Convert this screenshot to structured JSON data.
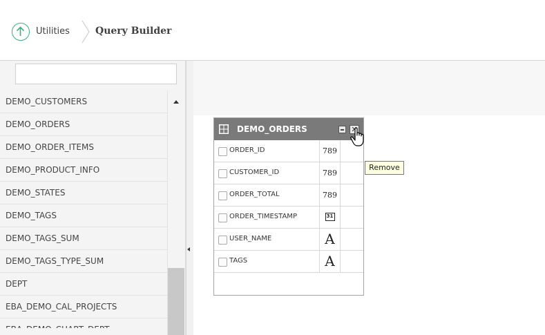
{
  "breadcrumb": {
    "parent": "Utilities",
    "current": "Query Builder"
  },
  "sidebar": {
    "search_value": "",
    "items": [
      "DEMO_CUSTOMERS",
      "DEMO_ORDERS",
      "DEMO_ORDER_ITEMS",
      "DEMO_PRODUCT_INFO",
      "DEMO_STATES",
      "DEMO_TAGS",
      "DEMO_TAGS_SUM",
      "DEMO_TAGS_TYPE_SUM",
      "DEPT",
      "EBA_DEMO_CAL_PROJECTS",
      "EBA_DEMO_CHART_DEPT"
    ]
  },
  "query_table": {
    "title": "DEMO_ORDERS",
    "columns": [
      {
        "name": "ORDER_ID",
        "type": "number",
        "type_symbol": "789"
      },
      {
        "name": "CUSTOMER_ID",
        "type": "number",
        "type_symbol": "789"
      },
      {
        "name": "ORDER_TOTAL",
        "type": "number",
        "type_symbol": "789"
      },
      {
        "name": "ORDER_TIMESTAMP",
        "type": "date",
        "type_symbol": "31"
      },
      {
        "name": "USER_NAME",
        "type": "string",
        "type_symbol": "A"
      },
      {
        "name": "TAGS",
        "type": "string",
        "type_symbol": "A"
      }
    ]
  },
  "tooltip": "Remove",
  "colors": {
    "accent_green": "#3ab07a",
    "table_header": "#7a7a7a",
    "tooltip_bg": "#ffffe1"
  }
}
